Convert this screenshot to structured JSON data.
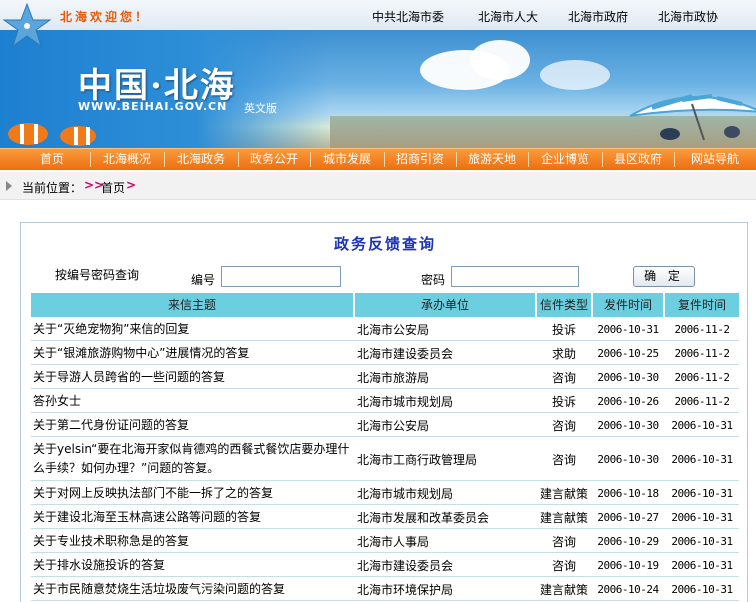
{
  "header": {
    "welcome": "北海欢迎您！",
    "top_links": [
      "中共北海市委",
      "北海市人大",
      "北海市政府",
      "北海市政协"
    ]
  },
  "banner": {
    "title": "中国·北海",
    "url": "WWW.BEIHAI.GOV.CN",
    "english_link": "英文版"
  },
  "nav": {
    "items": [
      "首页",
      "北海概况",
      "北海政务",
      "政务公开",
      "城市发展",
      "招商引资",
      "旅游天地",
      "企业博览",
      "县区政府",
      "网站导航"
    ]
  },
  "breadcrumb": {
    "label": "当前位置：",
    "sep": ">>",
    "home": "首页",
    "end": ">"
  },
  "panel": {
    "title": "政务反馈查询",
    "query_label": "按编号密码查询",
    "number_label": "编号",
    "password_label": "密码",
    "confirm_button": "确 定",
    "number_value": "",
    "password_value": ""
  },
  "table": {
    "headers": [
      "来信主题",
      "承办单位",
      "信件类型",
      "发件时间",
      "复件时间"
    ],
    "rows": [
      [
        "关于“灭绝宠物狗”来信的回复",
        "北海市公安局",
        "投诉",
        "2006-10-31",
        "2006-11-2"
      ],
      [
        "关于“银滩旅游购物中心”进展情况的答复",
        "北海市建设委员会",
        "求助",
        "2006-10-25",
        "2006-11-2"
      ],
      [
        "关于导游人员跨省的一些问题的答复",
        "北海市旅游局",
        "咨询",
        "2006-10-30",
        "2006-11-2"
      ],
      [
        "答孙女士",
        "北海市城市规划局",
        "投诉",
        "2006-10-26",
        "2006-11-2"
      ],
      [
        "关于第二代身份证问题的答复",
        "北海市公安局",
        "咨询",
        "2006-10-30",
        "2006-10-31"
      ],
      [
        "关于yelsin“要在北海开家似肯德鸡的西餐式餐饮店要办理什么手续？如何办理？”问题的答复。",
        "北海市工商行政管理局",
        "咨询",
        "2006-10-30",
        "2006-10-31"
      ],
      [
        "关于对网上反映执法部门不能一拆了之的答复",
        "北海市城市规划局",
        "建言献策",
        "2006-10-18",
        "2006-10-31"
      ],
      [
        "关于建设北海至玉林高速公路等问题的答复",
        "北海市发展和改革委员会",
        "建言献策",
        "2006-10-27",
        "2006-10-31"
      ],
      [
        "关于专业技术职称急是的答复",
        "北海市人事局",
        "咨询",
        "2006-10-29",
        "2006-10-31"
      ],
      [
        "关于排水设施投诉的答复",
        "北海市建设委员会",
        "咨询",
        "2006-10-19",
        "2006-10-31"
      ],
      [
        "关于市民随意焚烧生活垃圾废气污染问题的答复",
        "北海市环境保护局",
        "建言献策",
        "2006-10-24",
        "2006-10-31"
      ]
    ]
  },
  "colors": {
    "nav_orange": "#ec6f12",
    "welcome_orange": "#e85a08",
    "title_blue": "#1a33b8",
    "table_header": "#6ccfe0",
    "breadcrumb_sep": "#d4006b"
  }
}
